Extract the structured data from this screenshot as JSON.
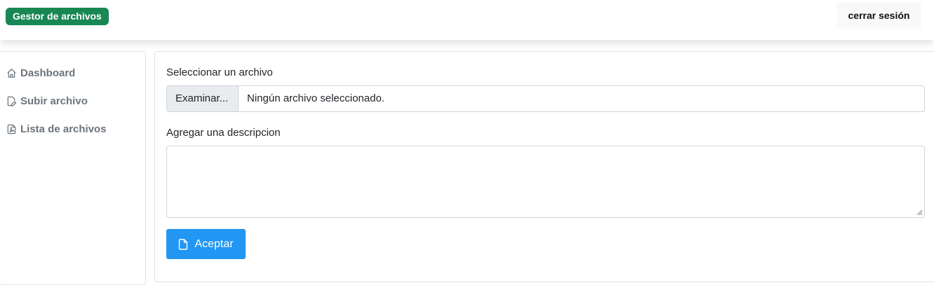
{
  "header": {
    "brand": "Gestor de archivos",
    "logout_label": "cerrar sesión"
  },
  "sidebar": {
    "items": [
      {
        "label": "Dashboard",
        "icon": "house-icon"
      },
      {
        "label": "Subir archivo",
        "icon": "file-edit-icon"
      },
      {
        "label": "Lista de archivos",
        "icon": "file-pdf-icon"
      }
    ]
  },
  "form": {
    "file_label": "Seleccionar un archivo",
    "browse_label": "Examinar...",
    "file_status": "Ningún archivo seleccionado.",
    "description_label": "Agregar una descripcion",
    "description_value": "",
    "submit_label": "Aceptar",
    "submit_icon": "file-icon"
  },
  "colors": {
    "brand_bg": "#198754",
    "submit_bg": "#2196f3",
    "nav_text": "#6c757d"
  }
}
